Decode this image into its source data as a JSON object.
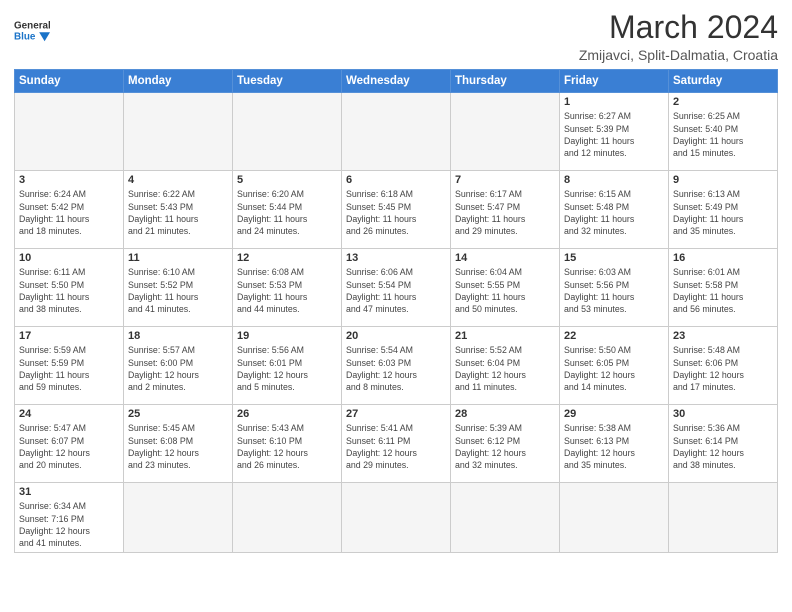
{
  "header": {
    "title": "March 2024",
    "subtitle": "Zmijavci, Split-Dalmatia, Croatia",
    "logo_general": "General",
    "logo_blue": "Blue"
  },
  "weekdays": [
    "Sunday",
    "Monday",
    "Tuesday",
    "Wednesday",
    "Thursday",
    "Friday",
    "Saturday"
  ],
  "weeks": [
    [
      {
        "day": "",
        "info": ""
      },
      {
        "day": "",
        "info": ""
      },
      {
        "day": "",
        "info": ""
      },
      {
        "day": "",
        "info": ""
      },
      {
        "day": "",
        "info": ""
      },
      {
        "day": "1",
        "info": "Sunrise: 6:27 AM\nSunset: 5:39 PM\nDaylight: 11 hours\nand 12 minutes."
      },
      {
        "day": "2",
        "info": "Sunrise: 6:25 AM\nSunset: 5:40 PM\nDaylight: 11 hours\nand 15 minutes."
      }
    ],
    [
      {
        "day": "3",
        "info": "Sunrise: 6:24 AM\nSunset: 5:42 PM\nDaylight: 11 hours\nand 18 minutes."
      },
      {
        "day": "4",
        "info": "Sunrise: 6:22 AM\nSunset: 5:43 PM\nDaylight: 11 hours\nand 21 minutes."
      },
      {
        "day": "5",
        "info": "Sunrise: 6:20 AM\nSunset: 5:44 PM\nDaylight: 11 hours\nand 24 minutes."
      },
      {
        "day": "6",
        "info": "Sunrise: 6:18 AM\nSunset: 5:45 PM\nDaylight: 11 hours\nand 26 minutes."
      },
      {
        "day": "7",
        "info": "Sunrise: 6:17 AM\nSunset: 5:47 PM\nDaylight: 11 hours\nand 29 minutes."
      },
      {
        "day": "8",
        "info": "Sunrise: 6:15 AM\nSunset: 5:48 PM\nDaylight: 11 hours\nand 32 minutes."
      },
      {
        "day": "9",
        "info": "Sunrise: 6:13 AM\nSunset: 5:49 PM\nDaylight: 11 hours\nand 35 minutes."
      }
    ],
    [
      {
        "day": "10",
        "info": "Sunrise: 6:11 AM\nSunset: 5:50 PM\nDaylight: 11 hours\nand 38 minutes."
      },
      {
        "day": "11",
        "info": "Sunrise: 6:10 AM\nSunset: 5:52 PM\nDaylight: 11 hours\nand 41 minutes."
      },
      {
        "day": "12",
        "info": "Sunrise: 6:08 AM\nSunset: 5:53 PM\nDaylight: 11 hours\nand 44 minutes."
      },
      {
        "day": "13",
        "info": "Sunrise: 6:06 AM\nSunset: 5:54 PM\nDaylight: 11 hours\nand 47 minutes."
      },
      {
        "day": "14",
        "info": "Sunrise: 6:04 AM\nSunset: 5:55 PM\nDaylight: 11 hours\nand 50 minutes."
      },
      {
        "day": "15",
        "info": "Sunrise: 6:03 AM\nSunset: 5:56 PM\nDaylight: 11 hours\nand 53 minutes."
      },
      {
        "day": "16",
        "info": "Sunrise: 6:01 AM\nSunset: 5:58 PM\nDaylight: 11 hours\nand 56 minutes."
      }
    ],
    [
      {
        "day": "17",
        "info": "Sunrise: 5:59 AM\nSunset: 5:59 PM\nDaylight: 11 hours\nand 59 minutes."
      },
      {
        "day": "18",
        "info": "Sunrise: 5:57 AM\nSunset: 6:00 PM\nDaylight: 12 hours\nand 2 minutes."
      },
      {
        "day": "19",
        "info": "Sunrise: 5:56 AM\nSunset: 6:01 PM\nDaylight: 12 hours\nand 5 minutes."
      },
      {
        "day": "20",
        "info": "Sunrise: 5:54 AM\nSunset: 6:03 PM\nDaylight: 12 hours\nand 8 minutes."
      },
      {
        "day": "21",
        "info": "Sunrise: 5:52 AM\nSunset: 6:04 PM\nDaylight: 12 hours\nand 11 minutes."
      },
      {
        "day": "22",
        "info": "Sunrise: 5:50 AM\nSunset: 6:05 PM\nDaylight: 12 hours\nand 14 minutes."
      },
      {
        "day": "23",
        "info": "Sunrise: 5:48 AM\nSunset: 6:06 PM\nDaylight: 12 hours\nand 17 minutes."
      }
    ],
    [
      {
        "day": "24",
        "info": "Sunrise: 5:47 AM\nSunset: 6:07 PM\nDaylight: 12 hours\nand 20 minutes."
      },
      {
        "day": "25",
        "info": "Sunrise: 5:45 AM\nSunset: 6:08 PM\nDaylight: 12 hours\nand 23 minutes."
      },
      {
        "day": "26",
        "info": "Sunrise: 5:43 AM\nSunset: 6:10 PM\nDaylight: 12 hours\nand 26 minutes."
      },
      {
        "day": "27",
        "info": "Sunrise: 5:41 AM\nSunset: 6:11 PM\nDaylight: 12 hours\nand 29 minutes."
      },
      {
        "day": "28",
        "info": "Sunrise: 5:39 AM\nSunset: 6:12 PM\nDaylight: 12 hours\nand 32 minutes."
      },
      {
        "day": "29",
        "info": "Sunrise: 5:38 AM\nSunset: 6:13 PM\nDaylight: 12 hours\nand 35 minutes."
      },
      {
        "day": "30",
        "info": "Sunrise: 5:36 AM\nSunset: 6:14 PM\nDaylight: 12 hours\nand 38 minutes."
      }
    ],
    [
      {
        "day": "31",
        "info": "Sunrise: 6:34 AM\nSunset: 7:16 PM\nDaylight: 12 hours\nand 41 minutes."
      },
      {
        "day": "",
        "info": ""
      },
      {
        "day": "",
        "info": ""
      },
      {
        "day": "",
        "info": ""
      },
      {
        "day": "",
        "info": ""
      },
      {
        "day": "",
        "info": ""
      },
      {
        "day": "",
        "info": ""
      }
    ]
  ]
}
